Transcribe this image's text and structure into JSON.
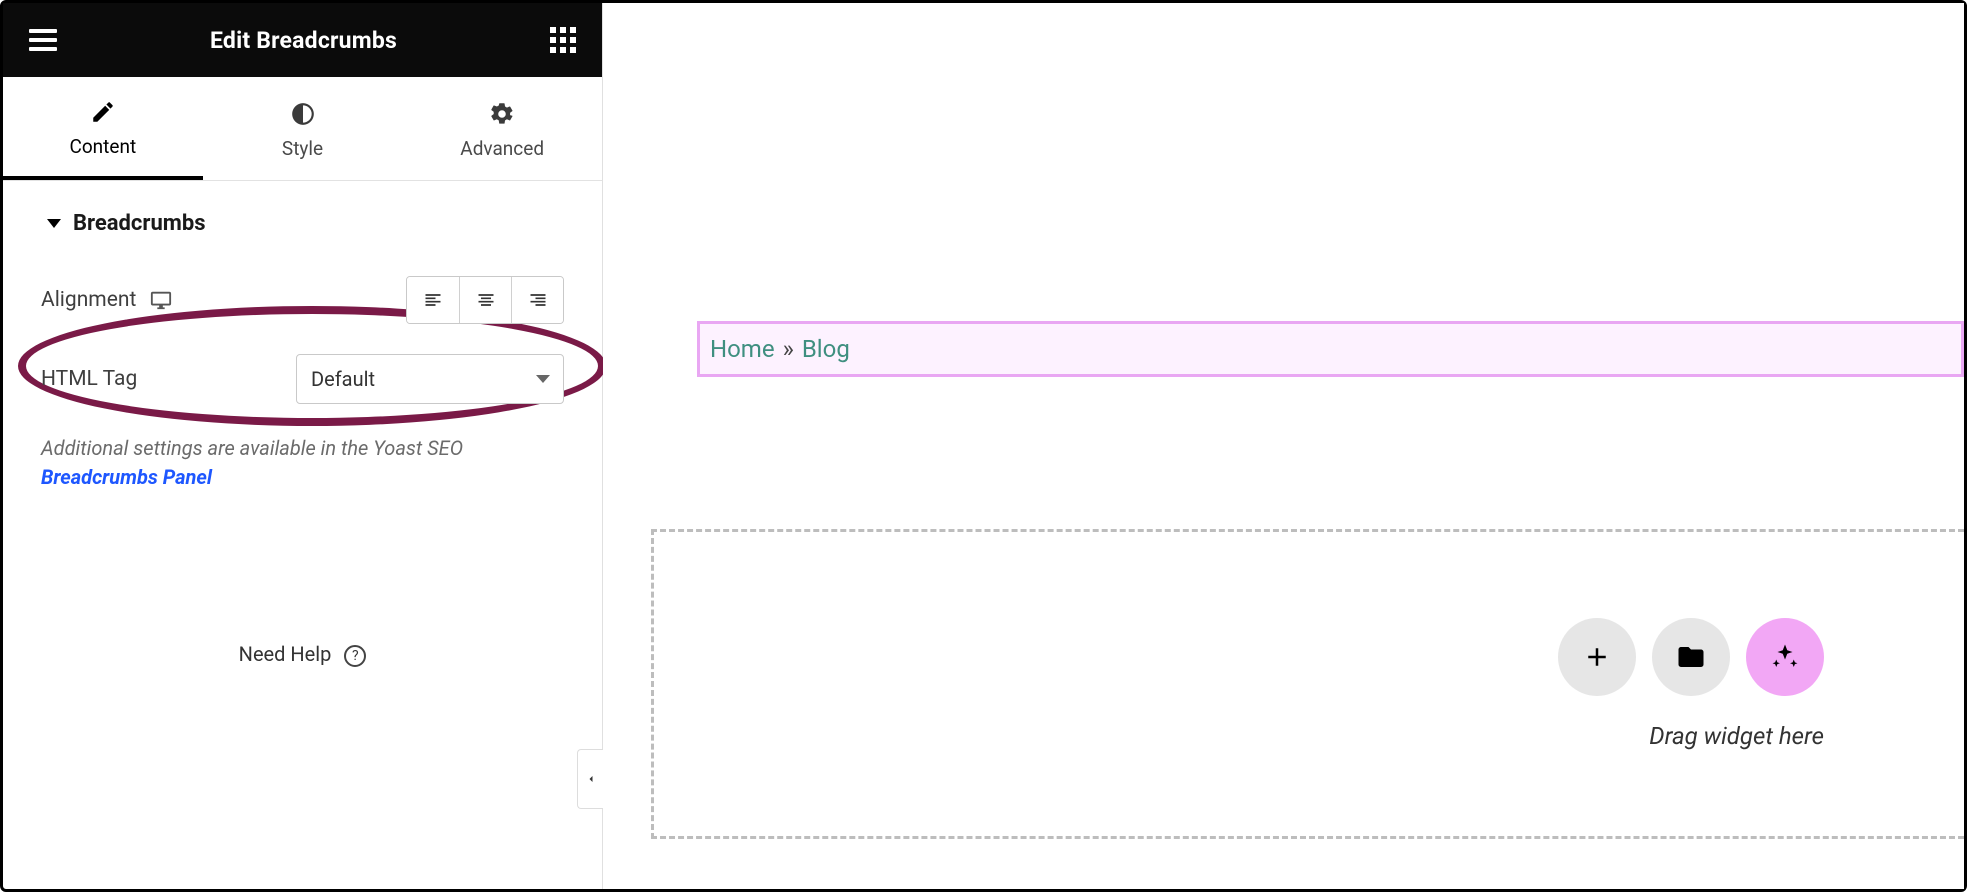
{
  "header": {
    "title": "Edit Breadcrumbs"
  },
  "tabs": [
    {
      "label": "Content",
      "active": true
    },
    {
      "label": "Style",
      "active": false
    },
    {
      "label": "Advanced",
      "active": false
    }
  ],
  "section": {
    "title": "Breadcrumbs"
  },
  "controls": {
    "alignment_label": "Alignment",
    "html_tag_label": "HTML Tag",
    "html_tag_value": "Default",
    "html_tag_options": [
      "Default"
    ]
  },
  "note": {
    "prefix": "Additional settings are available in the Yoast SEO ",
    "link": "Breadcrumbs Panel"
  },
  "help_label": "Need Help",
  "canvas": {
    "breadcrumb": {
      "home": "Home",
      "separator": "»",
      "current": "Blog"
    },
    "drop_hint": "Drag widget here"
  }
}
